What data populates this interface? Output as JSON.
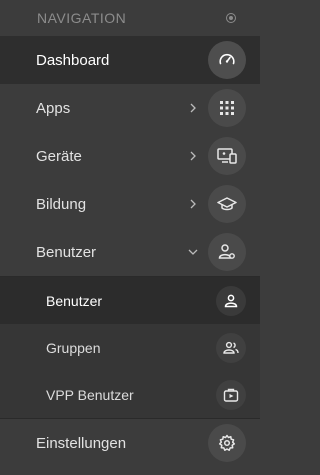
{
  "nav": {
    "header": "NAVIGATION",
    "items": [
      {
        "label": "Dashboard",
        "icon": "speedometer-icon",
        "active": true
      },
      {
        "label": "Apps",
        "icon": "grid-icon",
        "chevron": "right"
      },
      {
        "label": "Geräte",
        "icon": "devices-icon",
        "chevron": "right"
      },
      {
        "label": "Bildung",
        "icon": "graduation-cap-icon",
        "chevron": "right"
      },
      {
        "label": "Benutzer",
        "icon": "user-settings-icon",
        "chevron": "down"
      }
    ],
    "subitems": [
      {
        "label": "Benutzer",
        "icon": "user-icon",
        "active": true
      },
      {
        "label": "Gruppen",
        "icon": "group-icon"
      },
      {
        "label": "VPP Benutzer",
        "icon": "vpp-icon"
      }
    ],
    "footer": {
      "label": "Einstellungen",
      "icon": "gear-icon"
    }
  }
}
